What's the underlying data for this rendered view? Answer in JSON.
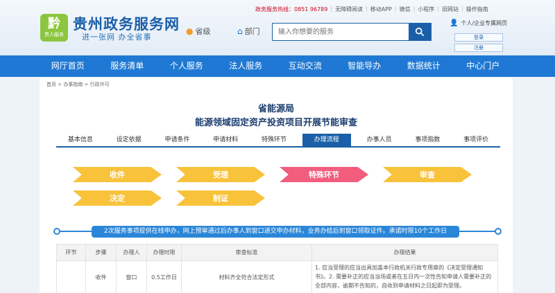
{
  "header": {
    "logo_text": "黔",
    "logo_sub": "贵人服务",
    "site_title": "贵州政务服务网",
    "slogan": "进一张网 办全省事",
    "location": "省级",
    "dept_label": "部门",
    "search_placeholder": "输入你想要的服务",
    "hotline": "政务服务热线：0851 96789",
    "top_links": [
      "无障碍阅读",
      "移动APP",
      "微信",
      "小程序",
      "旧网站",
      "操作指南"
    ],
    "user_label": "个人/企业专属网页",
    "login_label": "登录",
    "register_label": "注册"
  },
  "nav": [
    "网厅首页",
    "服务清单",
    "个人服务",
    "法人服务",
    "互动交流",
    "智能导办",
    "数据统计",
    "中心门户"
  ],
  "breadcrumb": "首页 > 办事指南 > 行政许可",
  "dept_title": "省能源局",
  "item_title": "能源领域固定资产投资项目开展节能审查",
  "tabs": [
    "基本信息",
    "设定依据",
    "申请条件",
    "申请材料",
    "特殊环节",
    "办理流程",
    "办事人员",
    "事项指数",
    "事项评价"
  ],
  "active_tab": "办理流程",
  "flow_steps": [
    "收件",
    "受理",
    "特殊环节",
    "审查",
    "决定",
    "制证"
  ],
  "timeline_note": "2次服务事项提供在线申办，网上预审通过后办事人到窗口递交申办材料，业务办结后到窗口领取证件。承诺时限10个工作日",
  "table": {
    "headers": [
      "环节",
      "步骤",
      "办理人",
      "办理时限",
      "审查标准",
      "办理结果"
    ],
    "row": {
      "step": "收件",
      "handler": "窗口",
      "time": "0.5工作日",
      "standard": "材料齐全符合法定形式",
      "result": "1. 应当受理的应当出具加盖本行政机关行政专用章的《决定受理通知书》。2. 需要补正的应当当场或者在五日内一次性告知申请人需要补正的全部内容，逾期不告知的，自收到申请材料之日起即为受理。"
    }
  },
  "colors": {
    "nav": "#1f79d4",
    "accent": "#1a5fa8",
    "step_yellow": "#f8c23a",
    "step_pink": "#f25d7e"
  }
}
